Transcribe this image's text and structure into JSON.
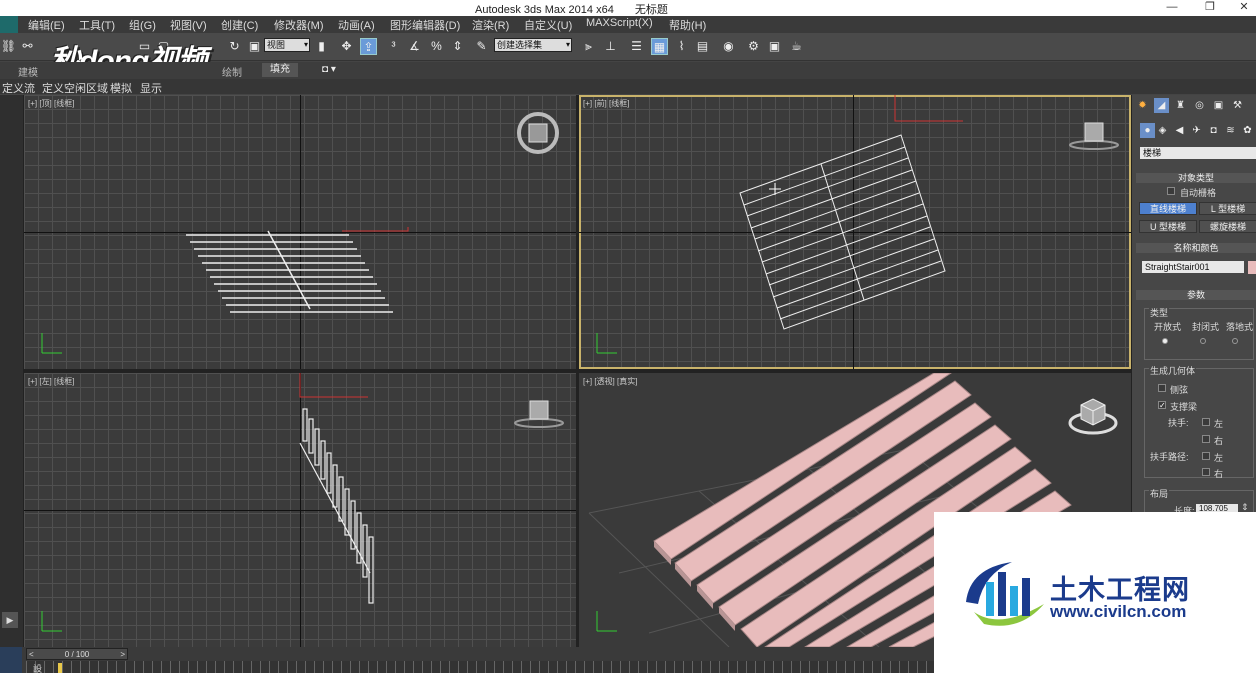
{
  "window": {
    "app": "Autodesk 3ds Max  2014 x64",
    "doc": "无标题",
    "min": "—",
    "max": "❐",
    "close": "✕"
  },
  "menu": [
    "编辑(E)",
    "工具(T)",
    "组(G)",
    "视图(V)",
    "创建(C)",
    "修改器(M)",
    "动画(A)",
    "图形编辑器(D)",
    "渲染(R)",
    "自定义(U)",
    "MAXScript(X)",
    "帮助(H)"
  ],
  "toolbar": {
    "view_select": "视图",
    "named_selection": "创建选择集"
  },
  "ribbon": {
    "tabs": [
      "建模",
      "绘制",
      "填充"
    ],
    "extra": "▾"
  },
  "subbar": [
    "定义流",
    "定义空闲区域",
    "模拟",
    "显示"
  ],
  "overlay_logo": "秒dong视频",
  "viewports": {
    "top": "[+] [顶] [线框]",
    "front": "[+] [前] [线框]",
    "left": "[+] [左] [线框]",
    "persp": "[+] [透视] [真实]",
    "top_cube": "顶",
    "front_cube": "前",
    "left_cube": "左"
  },
  "cmdpanel": {
    "category": "楼梯",
    "object_type_title": "对象类型",
    "auto_grid": "自动栅格",
    "btn_straight": "直线楼梯",
    "btn_l": "L 型楼梯",
    "btn_u": "U 型楼梯",
    "btn_spiral": "螺旋楼梯",
    "name_color_title": "名称和颜色",
    "object_name": "StraightStair001",
    "params_title": "参数",
    "type_label": "类型",
    "type_open": "开放式",
    "type_closed": "封闭式",
    "type_box": "落地式",
    "gen_geom": "生成几何体",
    "stringers": "侧弦",
    "carriage": "支撑梁",
    "handrail": "扶手:",
    "rail_path": "扶手路径:",
    "left": "左",
    "right": "右",
    "layout": "布局",
    "length_label": "长度:",
    "length_value": "108.705"
  },
  "timeline": {
    "frame": "0 / 100",
    "key": "設"
  },
  "watermark": {
    "name": "土木工程网",
    "url": "www.civilcn.com"
  },
  "colors": {
    "accent": "#4d80cf",
    "stair_pink": "#e8bcbc",
    "active_border": "#c9b36b",
    "wm_blue": "#1b3b8c"
  }
}
